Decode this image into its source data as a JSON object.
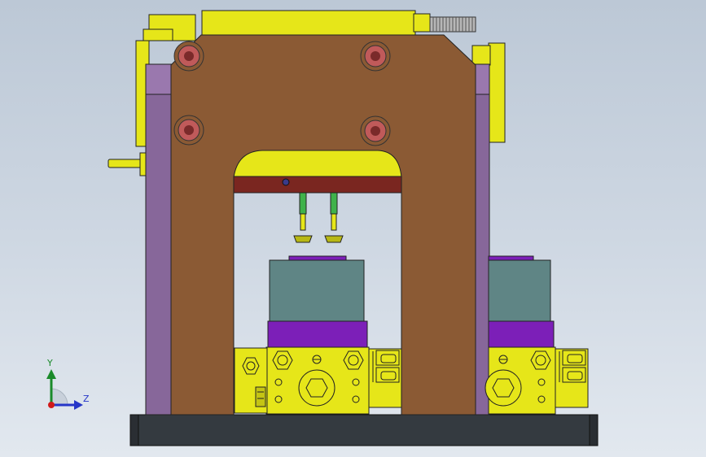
{
  "viewport": {
    "background_top": "#bcc8d6",
    "background_bottom": "#e2e8ef"
  },
  "model": {
    "frame_color": "#8b5a34",
    "guide_post_color": "#87679a",
    "base_color": "#343a40",
    "part_color": "#e6e619",
    "block_color": "#5f8585",
    "pad_color": "#7c1fb8",
    "bolt_color": "#c05a5a",
    "pin_color": "#3fb24a"
  },
  "triad": {
    "y_label": "Y",
    "z_label": "Z",
    "y_icon": "axis-y-arrow",
    "z_icon": "axis-z-arrow"
  }
}
